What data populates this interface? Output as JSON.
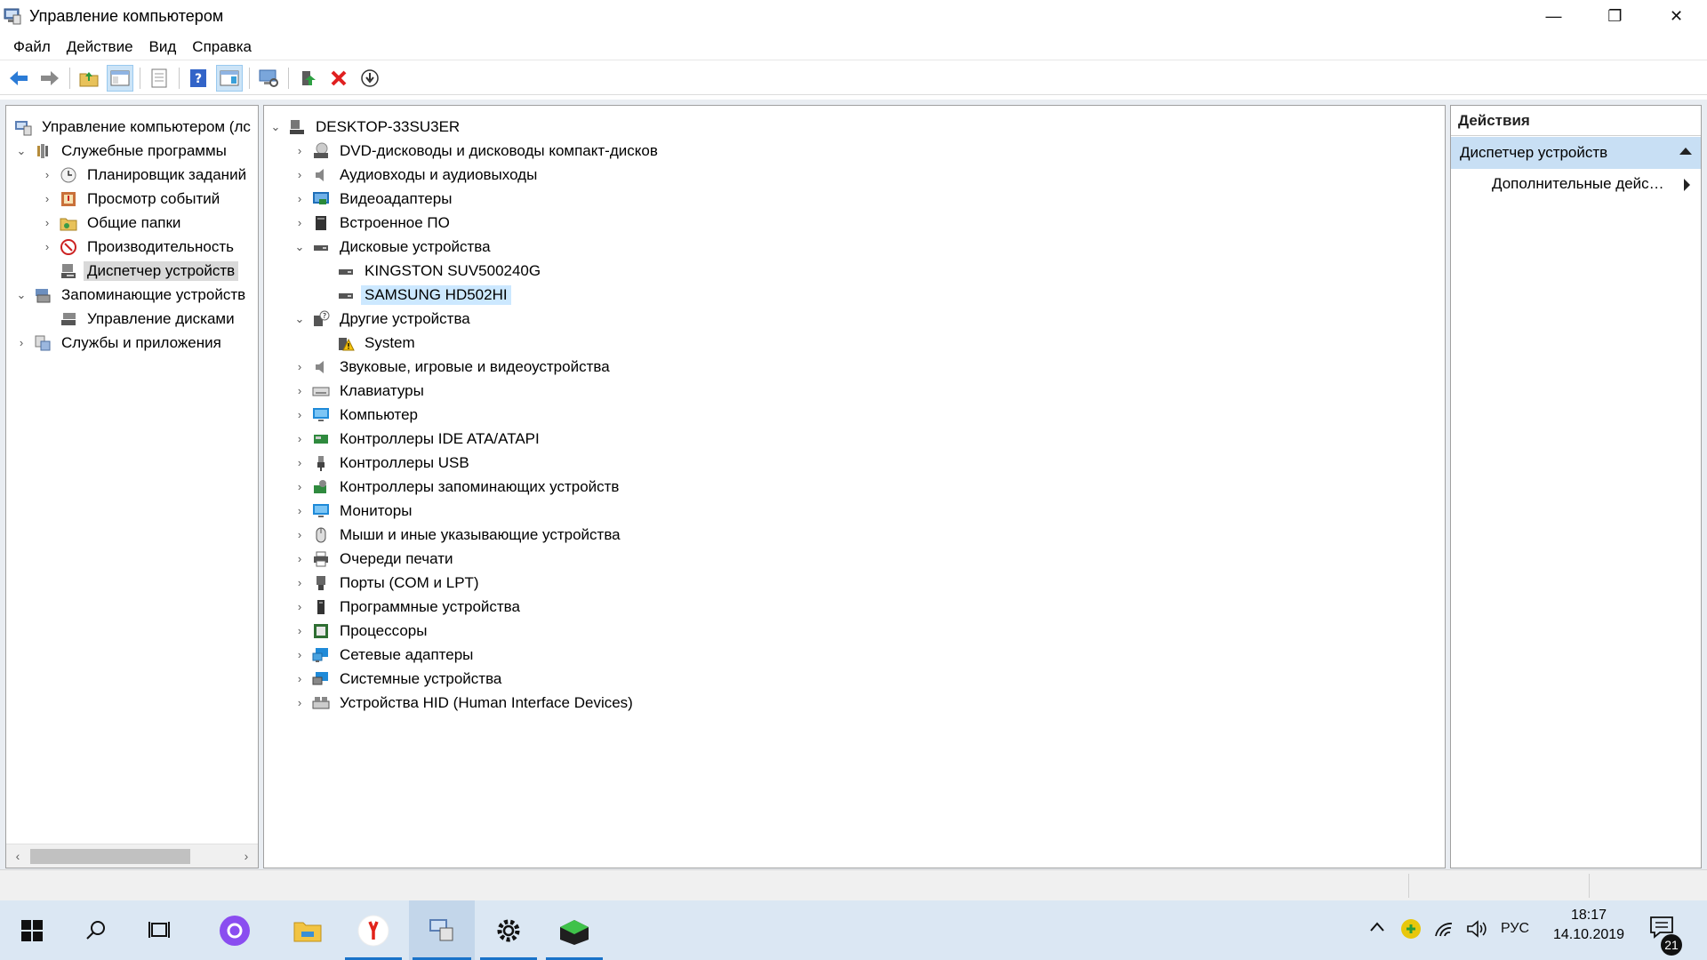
{
  "window": {
    "title": "Управление компьютером",
    "minimize_glyph": "—",
    "restore_glyph": "❐",
    "close_glyph": "✕"
  },
  "menu": [
    "Файл",
    "Действие",
    "Вид",
    "Справка"
  ],
  "left_tree": [
    {
      "label": "Управление компьютером (лс",
      "icon": "computer-management-icon",
      "expander": "",
      "level": 0
    },
    {
      "label": "Служебные программы",
      "icon": "tools-icon",
      "expander": "⌄",
      "level": 1
    },
    {
      "label": "Планировщик заданий",
      "icon": "clock-icon",
      "expander": "›",
      "level": 2
    },
    {
      "label": "Просмотр событий",
      "icon": "event-viewer-icon",
      "expander": "›",
      "level": 2
    },
    {
      "label": "Общие папки",
      "icon": "shared-folders-icon",
      "expander": "›",
      "level": 2
    },
    {
      "label": "Производительность",
      "icon": "performance-icon",
      "expander": "›",
      "level": 2
    },
    {
      "label": "Диспетчер устройств",
      "icon": "device-manager-icon",
      "expander": "",
      "level": 2,
      "selected": true
    },
    {
      "label": "Запоминающие устройств",
      "icon": "storage-icon",
      "expander": "⌄",
      "level": 1
    },
    {
      "label": "Управление дисками",
      "icon": "disk-management-icon",
      "expander": "",
      "level": 2
    },
    {
      "label": "Службы и приложения",
      "icon": "services-icon",
      "expander": "›",
      "level": 1
    }
  ],
  "device_tree": [
    {
      "label": "DESKTOP-33SU3ER",
      "icon": "computer-icon",
      "expander": "⌄",
      "level": 0
    },
    {
      "label": "DVD-дисководы и дисководы компакт-дисков",
      "icon": "dvd-drive-icon",
      "expander": "›",
      "level": 1
    },
    {
      "label": "Аудиовходы и аудиовыходы",
      "icon": "speaker-icon",
      "expander": "›",
      "level": 1
    },
    {
      "label": "Видеоадаптеры",
      "icon": "display-adapter-icon",
      "expander": "›",
      "level": 1
    },
    {
      "label": "Встроенное ПО",
      "icon": "firmware-icon",
      "expander": "›",
      "level": 1
    },
    {
      "label": "Дисковые устройства",
      "icon": "disk-drive-icon",
      "expander": "⌄",
      "level": 1
    },
    {
      "label": "KINGSTON SUV500240G",
      "icon": "disk-drive-icon",
      "expander": "",
      "level": 2
    },
    {
      "label": "SAMSUNG HD502HI",
      "icon": "disk-drive-icon",
      "expander": "",
      "level": 2,
      "selected": true
    },
    {
      "label": "Другие устройства",
      "icon": "unknown-device-icon",
      "expander": "⌄",
      "level": 1
    },
    {
      "label": "System",
      "icon": "warning-device-icon",
      "expander": "",
      "level": 2
    },
    {
      "label": "Звуковые, игровые и видеоустройства",
      "icon": "speaker-icon",
      "expander": "›",
      "level": 1
    },
    {
      "label": "Клавиатуры",
      "icon": "keyboard-icon",
      "expander": "›",
      "level": 1
    },
    {
      "label": "Компьютер",
      "icon": "monitor-icon",
      "expander": "›",
      "level": 1
    },
    {
      "label": "Контроллеры IDE ATA/ATAPI",
      "icon": "ide-controller-icon",
      "expander": "›",
      "level": 1
    },
    {
      "label": "Контроллеры USB",
      "icon": "usb-icon",
      "expander": "›",
      "level": 1
    },
    {
      "label": "Контроллеры запоминающих устройств",
      "icon": "storage-controller-icon",
      "expander": "›",
      "level": 1
    },
    {
      "label": "Мониторы",
      "icon": "monitor-icon",
      "expander": "›",
      "level": 1
    },
    {
      "label": "Мыши и иные указывающие устройства",
      "icon": "mouse-icon",
      "expander": "›",
      "level": 1
    },
    {
      "label": "Очереди печати",
      "icon": "printer-icon",
      "expander": "›",
      "level": 1
    },
    {
      "label": "Порты (COM и LPT)",
      "icon": "port-icon",
      "expander": "›",
      "level": 1
    },
    {
      "label": "Программные устройства",
      "icon": "software-device-icon",
      "expander": "›",
      "level": 1
    },
    {
      "label": "Процессоры",
      "icon": "processor-icon",
      "expander": "›",
      "level": 1
    },
    {
      "label": "Сетевые адаптеры",
      "icon": "network-adapter-icon",
      "expander": "›",
      "level": 1
    },
    {
      "label": "Системные устройства",
      "icon": "system-devices-icon",
      "expander": "›",
      "level": 1
    },
    {
      "label": "Устройства HID (Human Interface Devices)",
      "icon": "hid-icon",
      "expander": "›",
      "level": 1
    }
  ],
  "actions": {
    "header": "Действия",
    "section": "Диспетчер устройств",
    "item": "Дополнительные дейс…"
  },
  "taskbar": {
    "language": "РУС",
    "time": "18:17",
    "date": "14.10.2019",
    "notifications": "21"
  },
  "colors": {
    "selection_blue": "#cce8ff",
    "selection_gray": "#d9d9d9",
    "actions_band": "#c8dff4",
    "taskbar": "#dbe7f3"
  }
}
